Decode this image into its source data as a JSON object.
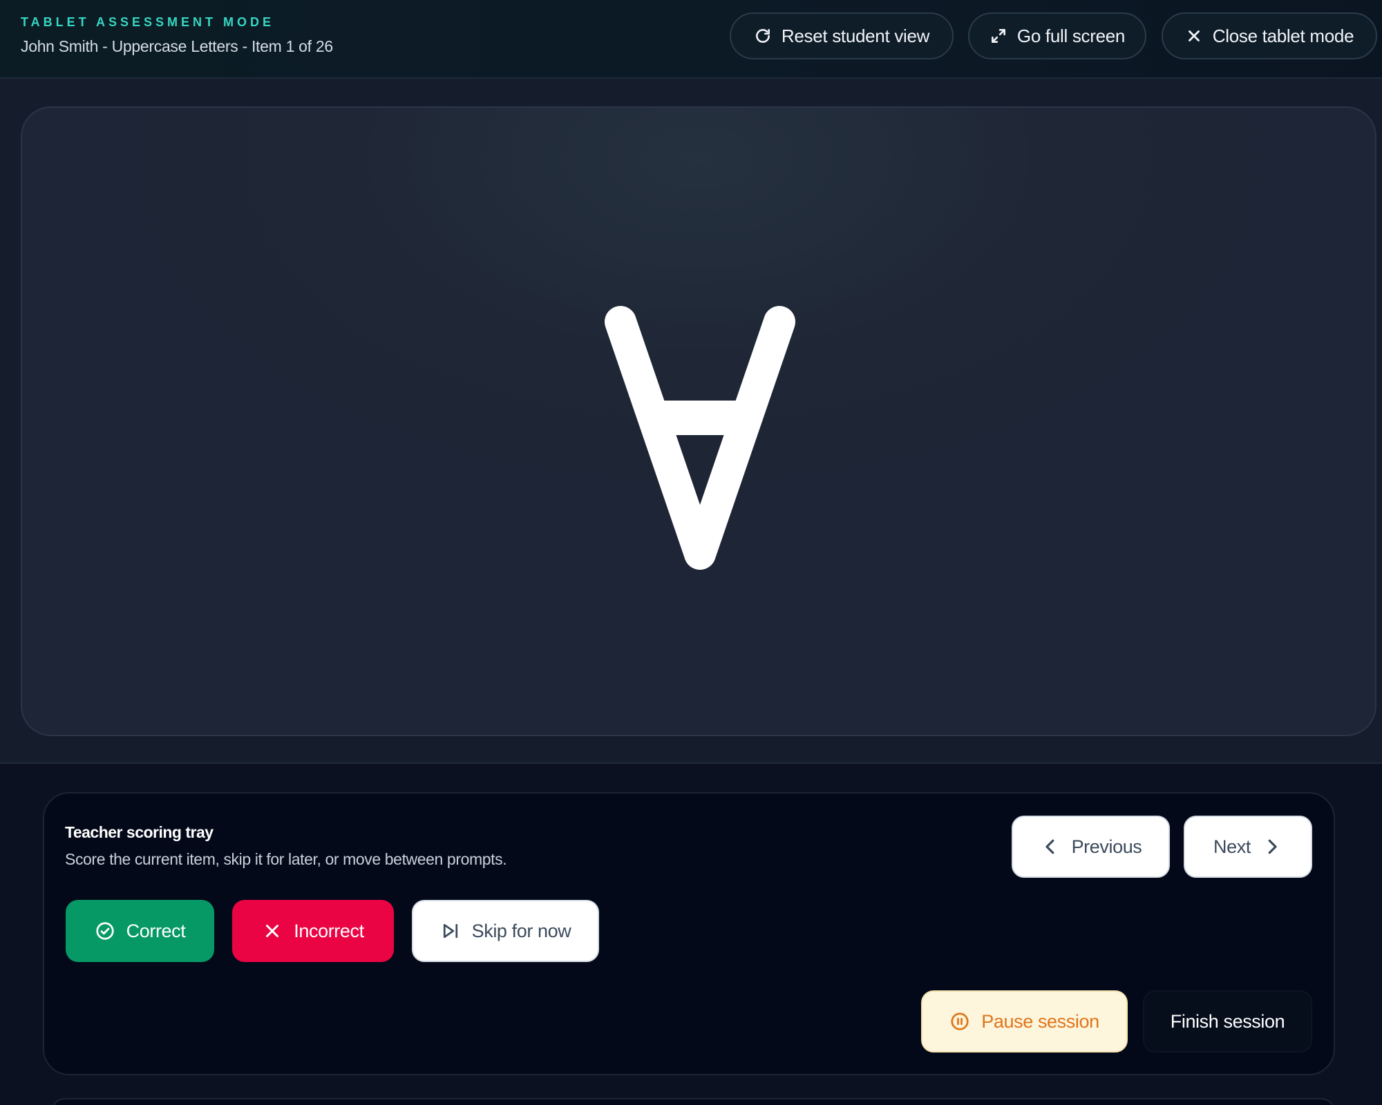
{
  "header": {
    "mode_label": "TABLET ASSESSMENT MODE",
    "session_info": "John Smith - Uppercase Letters - Item 1 of 26",
    "reset_label": "Reset student view",
    "fullscreen_label": "Go full screen",
    "close_label": "Close tablet mode"
  },
  "stage": {
    "current_item": "A",
    "orientation": "rotated-180"
  },
  "tray": {
    "title": "Teacher scoring tray",
    "subtitle": "Score the current item, skip it for later, or move between prompts.",
    "correct_label": "Correct",
    "incorrect_label": "Incorrect",
    "skip_label": "Skip for now",
    "previous_label": "Previous",
    "next_label": "Next",
    "pause_label": "Pause session",
    "finish_label": "Finish session"
  },
  "colors": {
    "accent_teal": "#37d6c2",
    "correct_green": "#069966",
    "incorrect_red": "#eb0444",
    "pause_orange": "#e0751a",
    "pause_bg": "#fdf5dc"
  }
}
